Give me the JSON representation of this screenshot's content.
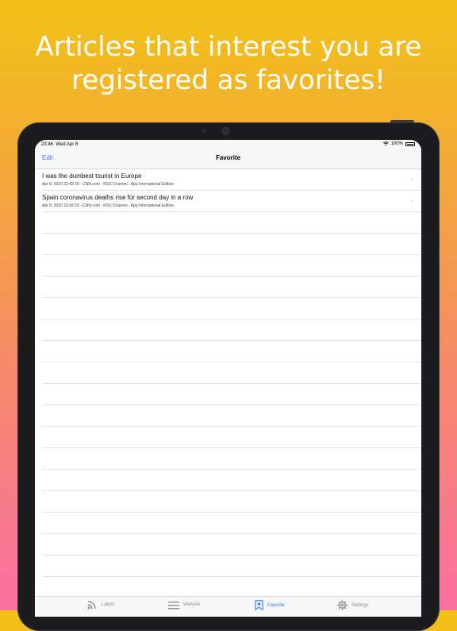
{
  "headline": {
    "line1": "Articles that interest you are",
    "line2": "registered as favorites!"
  },
  "status_bar": {
    "time": "23:46",
    "date": "Wed Apr 8",
    "battery": "100%",
    "battery_level": 1.0
  },
  "nav_bar": {
    "edit_label": "Edit",
    "title": "Favorite"
  },
  "favorites": [
    {
      "title": "I was the dumbest tourist in Europe",
      "meta": "Apr 8, 2020 23:42:29 - CNN.com - RSS Channel - App International Edition"
    },
    {
      "title": "Spain coronavirus deaths rise for second day in a row",
      "meta": "Apr 8, 2020 23:42:29 - CNN.com - RSS Channel - App International Edition"
    }
  ],
  "tabs": [
    {
      "label": "Latest",
      "icon": "rss-icon",
      "active": false
    },
    {
      "label": "Website",
      "icon": "list-icon",
      "active": false
    },
    {
      "label": "Favorite",
      "icon": "bookmark-star-icon",
      "active": true
    },
    {
      "label": "Settings",
      "icon": "gear-icon",
      "active": false
    }
  ],
  "colors": {
    "accent": "#2f7cf6",
    "gradient_top": "#f2c217",
    "gradient_bottom": "#fa6fa0",
    "tab_inactive": "#8e8e93"
  }
}
